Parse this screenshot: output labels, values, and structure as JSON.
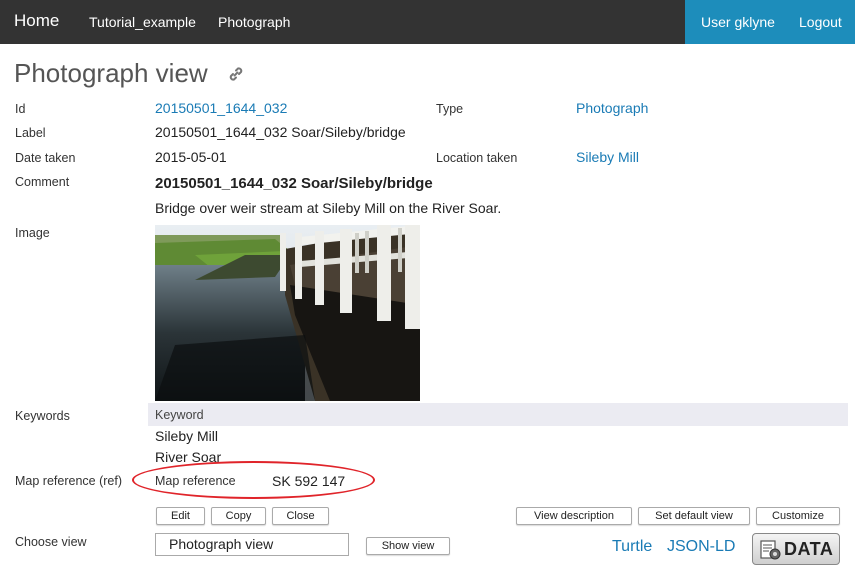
{
  "nav": {
    "home": "Home",
    "items": [
      "Tutorial_example",
      "Photograph"
    ],
    "user": "User gklyne",
    "logout": "Logout"
  },
  "page_title": "Photograph view",
  "fields": {
    "id_label": "Id",
    "id_value": "20150501_1644_032",
    "type_label": "Type",
    "type_value": "Photograph",
    "label_label": "Label",
    "label_value": "20150501_1644_032 Soar/Sileby/bridge",
    "date_label": "Date taken",
    "date_value": "2015-05-01",
    "location_label": "Location taken",
    "location_value": "Sileby Mill",
    "comment_label": "Comment",
    "comment_title": "20150501_1644_032 Soar/Sileby/bridge",
    "comment_body": "Bridge over weir stream at Sileby Mill on the River Soar.",
    "image_label": "Image",
    "keywords_label": "Keywords",
    "keyword_header": "Keyword",
    "keywords": [
      "Sileby Mill",
      "River Soar"
    ],
    "mapref_label": "Map reference (ref)",
    "mapref_inner_label": "Map reference",
    "mapref_value": "SK 592 147"
  },
  "buttons": {
    "edit": "Edit",
    "copy": "Copy",
    "close": "Close",
    "view_description": "View description",
    "set_default_view": "Set default view",
    "customize": "Customize",
    "show_view": "Show view"
  },
  "choose_view": {
    "label": "Choose view",
    "selected": "Photograph view"
  },
  "footer": {
    "turtle": "Turtle",
    "jsonld": "JSON-LD",
    "data": "DATA"
  },
  "colors": {
    "topbar": "#333333",
    "accent": "#1d8dbb",
    "link": "#1a7bb5",
    "highlight_ellipse": "#e0242a"
  }
}
